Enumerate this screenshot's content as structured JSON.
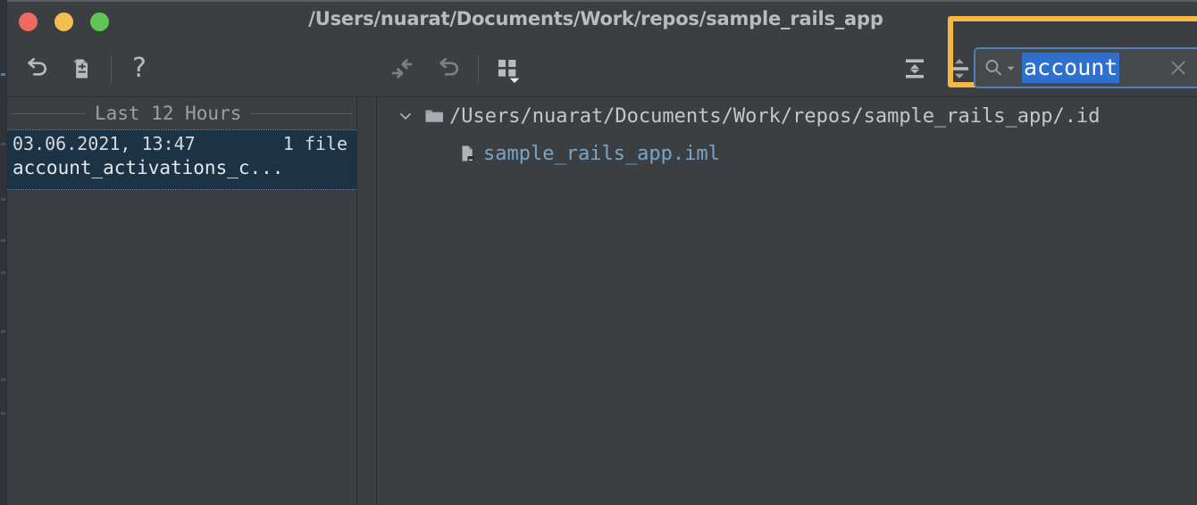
{
  "window": {
    "title": "/Users/nuarat/Documents/Work/repos/sample_rails_app",
    "traffic_lights": [
      {
        "name": "close",
        "color": "#ec6a5f"
      },
      {
        "name": "minimize",
        "color": "#f4bd4f"
      },
      {
        "name": "maximize",
        "color": "#61c555"
      }
    ]
  },
  "toolbar": {
    "left_buttons": [
      {
        "name": "revert-icon",
        "label": "Revert"
      },
      {
        "name": "create-patch-icon",
        "label": "Create Patch"
      },
      {
        "name": "help-icon",
        "label": "?"
      }
    ],
    "center_buttons": [
      {
        "name": "collapse-selection-icon",
        "label": "Revert Selection"
      },
      {
        "name": "undo-icon",
        "label": "Undo"
      },
      {
        "name": "group-by-icon",
        "label": "Group By"
      }
    ],
    "right_buttons": [
      {
        "name": "collapse-all-icon",
        "label": "Collapse All"
      },
      {
        "name": "expand-all-icon",
        "label": "Expand All"
      }
    ]
  },
  "search": {
    "value": "account",
    "placeholder": "Search",
    "icon": "search-icon",
    "dropdown_icon": "chevron-down-icon",
    "clear_icon": "close-icon",
    "selected": true,
    "selection_color": "#2f6fd0",
    "focus_border_color": "#4d7fb8"
  },
  "annotation": {
    "color": "#f5b942",
    "target": "search-field"
  },
  "left_panel": {
    "group_label": "Last 12 Hours",
    "revisions": [
      {
        "timestamp": "03.06.2021, 13:47",
        "file_count": "1 file",
        "name": "account_activations_c...",
        "selected": true
      }
    ]
  },
  "right_panel": {
    "tree": [
      {
        "level": 0,
        "expanded": true,
        "chevron": "chevron-down-icon",
        "icon": "folder-icon",
        "label": "/Users/nuarat/Documents/Work/repos/sample_rails_app/.id",
        "kind": "folder"
      },
      {
        "level": 1,
        "expanded": false,
        "chevron": null,
        "icon": "iml-file-icon",
        "label": "sample_rails_app.iml",
        "kind": "file"
      }
    ]
  }
}
